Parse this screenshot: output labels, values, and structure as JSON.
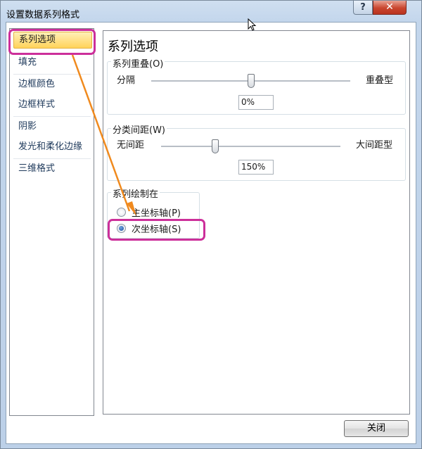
{
  "window": {
    "title": "设置数据系列格式",
    "help_label": "?",
    "close_label": "✕"
  },
  "nav": {
    "items": [
      {
        "label": "系列选项",
        "selected": true
      },
      {
        "label": "填充"
      },
      {
        "label": "边框颜色"
      },
      {
        "label": "边框样式"
      },
      {
        "label": "阴影"
      },
      {
        "label": "发光和柔化边缘"
      },
      {
        "label": "三维格式"
      }
    ]
  },
  "content": {
    "title": "系列选项",
    "overlap": {
      "legend": "系列重叠(O)",
      "left_label": "分隔",
      "right_label": "重叠型",
      "value": "0%",
      "slider_fraction": 0.5
    },
    "gap": {
      "legend": "分类间距(W)",
      "left_label": "无间距",
      "right_label": "大间距型",
      "value": "150%",
      "slider_fraction": 0.3
    },
    "plot_on": {
      "legend": "系列绘制在",
      "options": [
        {
          "label": "主坐标轴(P)",
          "checked": false
        },
        {
          "label": "次坐标轴(S)",
          "checked": true
        }
      ]
    }
  },
  "footer": {
    "close_button_label": "关闭"
  },
  "annotation_colors": {
    "highlight": "#cc2f9a",
    "arrow": "#f08a1e"
  }
}
